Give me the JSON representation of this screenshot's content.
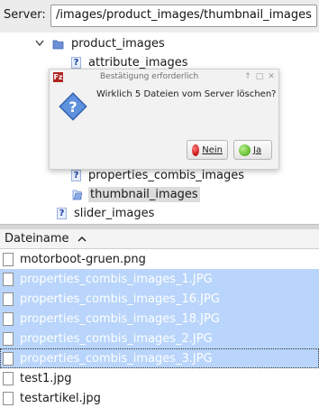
{
  "server_bar": {
    "label": "Server:",
    "path_value": "/images/product_images/thumbnail_images"
  },
  "tree": {
    "items": [
      {
        "label": "product_images",
        "icon": "folder-icon",
        "expanded": true
      },
      {
        "label": "attribute_images",
        "icon": "question-icon"
      },
      {
        "label": "properties_combis_images",
        "icon": "question-icon"
      },
      {
        "label": "thumbnail_images",
        "icon": "folder-icon",
        "selected": true
      },
      {
        "label": "slider_images",
        "icon": "question-icon"
      }
    ]
  },
  "filelist": {
    "column_header": "Dateiname",
    "sort": "ascending",
    "files": [
      {
        "name": "motorboot-gruen.png",
        "selected": false
      },
      {
        "name": "properties_combis_images_1.JPG",
        "selected": true
      },
      {
        "name": "properties_combis_images_16.JPG",
        "selected": true
      },
      {
        "name": "properties_combis_images_18.JPG",
        "selected": true
      },
      {
        "name": "properties_combis_images_2.JPG",
        "selected": true
      },
      {
        "name": "properties_combis_images_3.JPG",
        "selected": true
      },
      {
        "name": "test1.jpg",
        "selected": false
      },
      {
        "name": "testartikel.jpg",
        "selected": false
      }
    ]
  },
  "dialog": {
    "title": "Bestätigung erforderlich",
    "app_icon_text": "Fz",
    "message": "Wirklich 5 Dateien vom Server löschen?",
    "no_label": "Nein",
    "yes_label": "Ja",
    "icon": "question-icon"
  },
  "colors": {
    "selection": "#b9d5fb",
    "no_button": "#d11f1f",
    "yes_button": "#6cc13a"
  }
}
